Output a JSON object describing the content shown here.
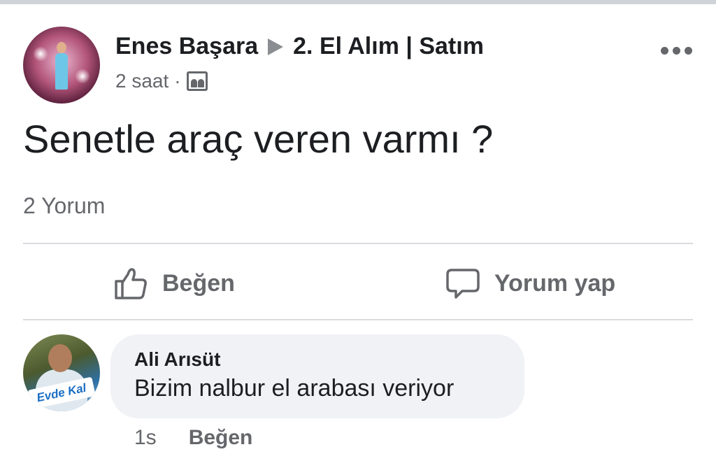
{
  "post": {
    "author_name": "Enes Başara",
    "group_name": "2. El Alım | Satım",
    "time": "2 saat",
    "separator": "·",
    "text": "Senetle araç veren varmı ?",
    "comment_count": "2 Yorum"
  },
  "actions": {
    "like_label": "Beğen",
    "comment_label": "Yorum yap"
  },
  "comment": {
    "author_name": "Ali Arısüt",
    "text": "Bizim nalbur el arabası veriyor",
    "time": "1s",
    "like_label": "Beğen",
    "avatar_badge_text": "Evde Kal"
  },
  "colors": {
    "text_primary": "#1c1e21",
    "text_secondary": "#65676b",
    "bubble_bg": "#f0f2f5",
    "divider": "#d9dbde"
  },
  "icons": [
    "arrow-right-icon",
    "group-privacy-icon",
    "more-options-icon",
    "thumbs-up-icon",
    "comment-bubble-icon"
  ]
}
